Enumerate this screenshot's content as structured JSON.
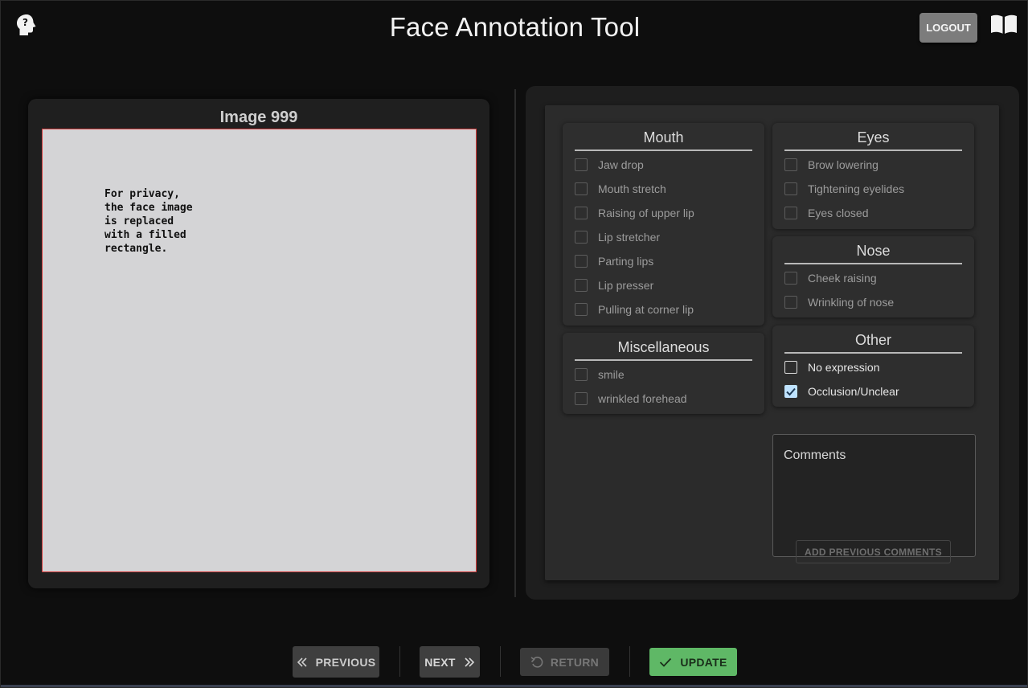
{
  "header": {
    "title": "Face Annotation Tool",
    "logout_label": "LOGOUT",
    "help_icon": "help-head-icon",
    "guide_icon": "open-book-icon"
  },
  "image_panel": {
    "title": "Image 999",
    "placeholder_text": "For privacy,\nthe face image\nis replaced\nwith a filled\nrectangle."
  },
  "groups": {
    "mouth": {
      "title": "Mouth",
      "options": [
        {
          "label": "Jaw drop",
          "checked": false
        },
        {
          "label": "Mouth stretch",
          "checked": false
        },
        {
          "label": "Raising of upper lip",
          "checked": false
        },
        {
          "label": "Lip stretcher",
          "checked": false
        },
        {
          "label": "Parting lips",
          "checked": false
        },
        {
          "label": "Lip presser",
          "checked": false
        },
        {
          "label": "Pulling at corner lip",
          "checked": false
        }
      ]
    },
    "eyes": {
      "title": "Eyes",
      "options": [
        {
          "label": "Brow lowering",
          "checked": false
        },
        {
          "label": "Tightening eyelides",
          "checked": false
        },
        {
          "label": "Eyes closed",
          "checked": false
        }
      ]
    },
    "nose": {
      "title": "Nose",
      "options": [
        {
          "label": "Cheek raising",
          "checked": false
        },
        {
          "label": "Wrinkling of nose",
          "checked": false
        }
      ]
    },
    "misc": {
      "title": "Miscellaneous",
      "options": [
        {
          "label": "smile",
          "checked": false
        },
        {
          "label": "wrinkled forehead",
          "checked": false
        }
      ]
    },
    "other": {
      "title": "Other",
      "options": [
        {
          "label": "No expression",
          "checked": false
        },
        {
          "label": "Occlusion/Unclear",
          "checked": true
        }
      ]
    }
  },
  "comments": {
    "placeholder": "Comments",
    "add_previous_label": "ADD PREVIOUS COMMENTS"
  },
  "nav": {
    "previous_label": "PREVIOUS",
    "next_label": "NEXT",
    "return_label": "RETURN",
    "update_label": "UPDATE"
  },
  "colors": {
    "accent_update": "#5fb866",
    "checkbox_checked": "#bfe3ff",
    "image_border": "#d23c3c"
  }
}
